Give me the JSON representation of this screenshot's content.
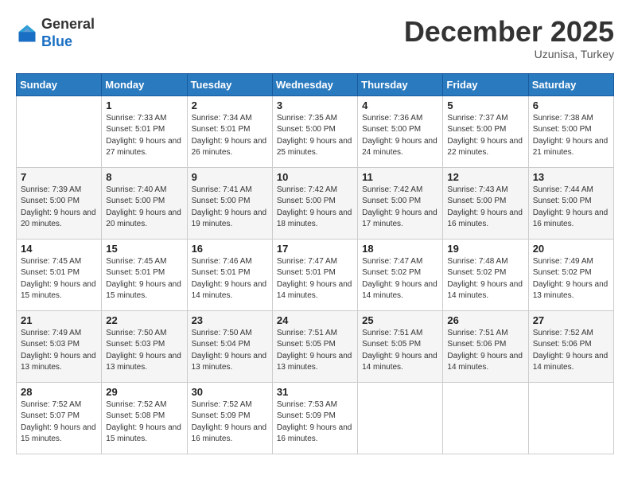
{
  "header": {
    "logo_line1": "General",
    "logo_line2": "Blue",
    "month_year": "December 2025",
    "location": "Uzunisa, Turkey"
  },
  "days_of_week": [
    "Sunday",
    "Monday",
    "Tuesday",
    "Wednesday",
    "Thursday",
    "Friday",
    "Saturday"
  ],
  "weeks": [
    [
      {
        "day": "",
        "info": ""
      },
      {
        "day": "1",
        "info": "Sunrise: 7:33 AM\nSunset: 5:01 PM\nDaylight: 9 hours\nand 27 minutes."
      },
      {
        "day": "2",
        "info": "Sunrise: 7:34 AM\nSunset: 5:01 PM\nDaylight: 9 hours\nand 26 minutes."
      },
      {
        "day": "3",
        "info": "Sunrise: 7:35 AM\nSunset: 5:00 PM\nDaylight: 9 hours\nand 25 minutes."
      },
      {
        "day": "4",
        "info": "Sunrise: 7:36 AM\nSunset: 5:00 PM\nDaylight: 9 hours\nand 24 minutes."
      },
      {
        "day": "5",
        "info": "Sunrise: 7:37 AM\nSunset: 5:00 PM\nDaylight: 9 hours\nand 22 minutes."
      },
      {
        "day": "6",
        "info": "Sunrise: 7:38 AM\nSunset: 5:00 PM\nDaylight: 9 hours\nand 21 minutes."
      }
    ],
    [
      {
        "day": "7",
        "info": "Sunrise: 7:39 AM\nSunset: 5:00 PM\nDaylight: 9 hours\nand 20 minutes."
      },
      {
        "day": "8",
        "info": "Sunrise: 7:40 AM\nSunset: 5:00 PM\nDaylight: 9 hours\nand 20 minutes."
      },
      {
        "day": "9",
        "info": "Sunrise: 7:41 AM\nSunset: 5:00 PM\nDaylight: 9 hours\nand 19 minutes."
      },
      {
        "day": "10",
        "info": "Sunrise: 7:42 AM\nSunset: 5:00 PM\nDaylight: 9 hours\nand 18 minutes."
      },
      {
        "day": "11",
        "info": "Sunrise: 7:42 AM\nSunset: 5:00 PM\nDaylight: 9 hours\nand 17 minutes."
      },
      {
        "day": "12",
        "info": "Sunrise: 7:43 AM\nSunset: 5:00 PM\nDaylight: 9 hours\nand 16 minutes."
      },
      {
        "day": "13",
        "info": "Sunrise: 7:44 AM\nSunset: 5:00 PM\nDaylight: 9 hours\nand 16 minutes."
      }
    ],
    [
      {
        "day": "14",
        "info": "Sunrise: 7:45 AM\nSunset: 5:01 PM\nDaylight: 9 hours\nand 15 minutes."
      },
      {
        "day": "15",
        "info": "Sunrise: 7:45 AM\nSunset: 5:01 PM\nDaylight: 9 hours\nand 15 minutes."
      },
      {
        "day": "16",
        "info": "Sunrise: 7:46 AM\nSunset: 5:01 PM\nDaylight: 9 hours\nand 14 minutes."
      },
      {
        "day": "17",
        "info": "Sunrise: 7:47 AM\nSunset: 5:01 PM\nDaylight: 9 hours\nand 14 minutes."
      },
      {
        "day": "18",
        "info": "Sunrise: 7:47 AM\nSunset: 5:02 PM\nDaylight: 9 hours\nand 14 minutes."
      },
      {
        "day": "19",
        "info": "Sunrise: 7:48 AM\nSunset: 5:02 PM\nDaylight: 9 hours\nand 14 minutes."
      },
      {
        "day": "20",
        "info": "Sunrise: 7:49 AM\nSunset: 5:02 PM\nDaylight: 9 hours\nand 13 minutes."
      }
    ],
    [
      {
        "day": "21",
        "info": "Sunrise: 7:49 AM\nSunset: 5:03 PM\nDaylight: 9 hours\nand 13 minutes."
      },
      {
        "day": "22",
        "info": "Sunrise: 7:50 AM\nSunset: 5:03 PM\nDaylight: 9 hours\nand 13 minutes."
      },
      {
        "day": "23",
        "info": "Sunrise: 7:50 AM\nSunset: 5:04 PM\nDaylight: 9 hours\nand 13 minutes."
      },
      {
        "day": "24",
        "info": "Sunrise: 7:51 AM\nSunset: 5:05 PM\nDaylight: 9 hours\nand 13 minutes."
      },
      {
        "day": "25",
        "info": "Sunrise: 7:51 AM\nSunset: 5:05 PM\nDaylight: 9 hours\nand 14 minutes."
      },
      {
        "day": "26",
        "info": "Sunrise: 7:51 AM\nSunset: 5:06 PM\nDaylight: 9 hours\nand 14 minutes."
      },
      {
        "day": "27",
        "info": "Sunrise: 7:52 AM\nSunset: 5:06 PM\nDaylight: 9 hours\nand 14 minutes."
      }
    ],
    [
      {
        "day": "28",
        "info": "Sunrise: 7:52 AM\nSunset: 5:07 PM\nDaylight: 9 hours\nand 15 minutes."
      },
      {
        "day": "29",
        "info": "Sunrise: 7:52 AM\nSunset: 5:08 PM\nDaylight: 9 hours\nand 15 minutes."
      },
      {
        "day": "30",
        "info": "Sunrise: 7:52 AM\nSunset: 5:09 PM\nDaylight: 9 hours\nand 16 minutes."
      },
      {
        "day": "31",
        "info": "Sunrise: 7:53 AM\nSunset: 5:09 PM\nDaylight: 9 hours\nand 16 minutes."
      },
      {
        "day": "",
        "info": ""
      },
      {
        "day": "",
        "info": ""
      },
      {
        "day": "",
        "info": ""
      }
    ]
  ]
}
